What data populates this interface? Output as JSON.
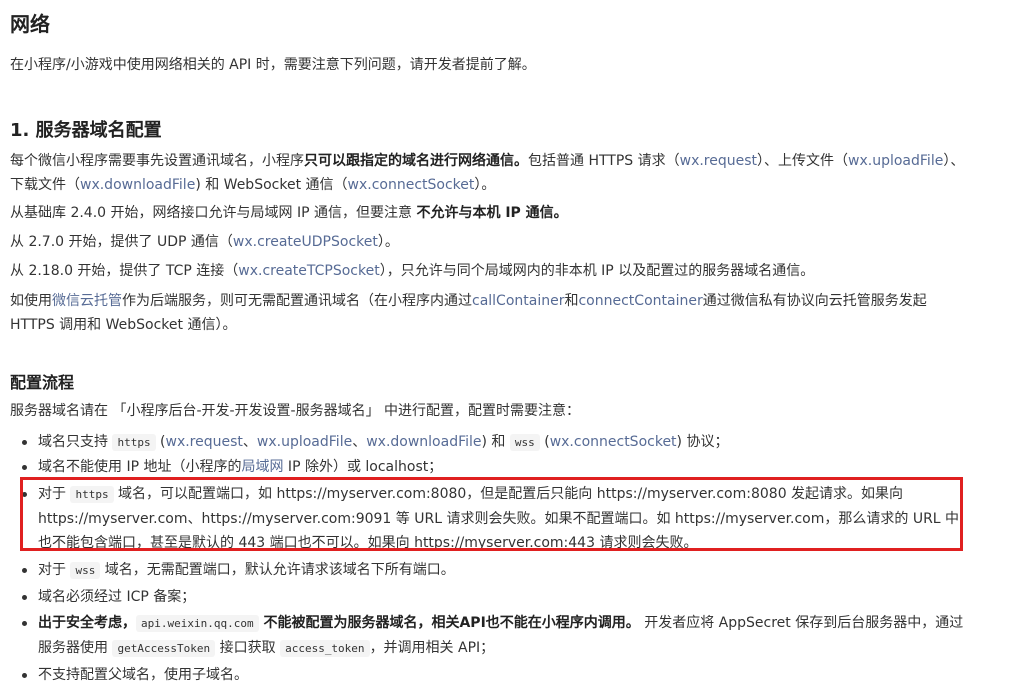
{
  "title": "网络",
  "intro": "在小程序/小游戏中使用网络相关的 API 时，需要注意下列问题，请开发者提前了解。",
  "section1": {
    "heading": "1. 服务器域名配置",
    "p1": {
      "a": "每个微信小程序需要事先设置通讯域名，小程序",
      "b": "只可以跟指定的域名进行网络通信。",
      "c": "包括普通 HTTPS 请求（",
      "link1": "wx.request",
      "d": "）、上传文件（",
      "link2": "wx.uploadFile",
      "e": "）、下载文件（",
      "link3": "wx.downloadFile",
      "f": ") 和 WebSocket 通信（",
      "link4": "wx.connectSocket",
      "g": "）。"
    },
    "p2": {
      "a": "从基础库 2.4.0 开始，网络接口允许与局域网 IP 通信，但要注意 ",
      "b": "不允许与本机 IP 通信。"
    },
    "p3": {
      "a": "从 2.7.0 开始，提供了 UDP 通信（",
      "link": "wx.createUDPSocket",
      "b": "）。"
    },
    "p4": {
      "a": "从 2.18.0 开始，提供了 TCP 连接（",
      "link": "wx.createTCPSocket",
      "b": "），只允许与同个局域网内的非本机 IP 以及配置过的服务器域名通信。"
    },
    "p5": {
      "a": "如使用",
      "link1": "微信云托管",
      "b": "作为后端服务，则可无需配置通讯域名（在小程序内通过",
      "link2": "callContainer",
      "c": "和",
      "link3": "connectContainer",
      "d": "通过微信私有协议向云托管服务发起 HTTPS 调用和 WebSocket 通信）。"
    }
  },
  "flow": {
    "heading": "配置流程",
    "intro": "服务器域名请在 「小程序后台-开发-开发设置-服务器域名」 中进行配置，配置时需要注意：",
    "items": {
      "i1": {
        "a": "域名只支持 ",
        "code1": "https",
        "b": " (",
        "link1": "wx.request",
        "c": "、",
        "link2": "wx.uploadFile",
        "d": "、",
        "link3": "wx.downloadFile",
        "e": ") 和 ",
        "code2": "wss",
        "f": " (",
        "link4": "wx.connectSocket",
        "g": ") 协议；"
      },
      "i2": {
        "a": "域名不能使用 IP 地址（小程序的",
        "link": "局域网",
        "b": " IP 除外）或 localhost；"
      },
      "i3": {
        "a": "对于 ",
        "code": "https",
        "b": " 域名，可以配置端口，如 https://myserver.com:8080，但是配置后只能向 https://myserver.com:8080 发起请求。如果向 https://myserver.com、https://myserver.com:9091 等 URL 请求则会失败。如果不配置端口。如 https://myserver.com，那么请求的 URL 中也不能包含端口，甚至是默认的 443 端口也不可以。如果向 https://myserver.com:443 请求则会失败。"
      },
      "i4": {
        "a": "对于 ",
        "code": "wss",
        "b": " 域名，无需配置端口，默认允许请求该域名下所有端口。"
      },
      "i5": {
        "a": "域名必须经过 ICP 备案；"
      },
      "i6": {
        "b1": "出于安全考虑，",
        "code1": "api.weixin.qq.com",
        "b2": " 不能被配置为服务器域名，相关API也不能在小程序内调用。",
        "a": " 开发者应将 AppSecret 保存到后台服务器中，通过服务器使用 ",
        "code2": "getAccessToken",
        "c": " 接口获取 ",
        "code3": "access_token",
        "d": "，并调用相关 API；"
      },
      "i7": {
        "a": "不支持配置父域名，使用子域名。"
      }
    }
  },
  "colors": {
    "link": "#576b95",
    "highlight_border": "#e02020",
    "text": "#333333"
  }
}
